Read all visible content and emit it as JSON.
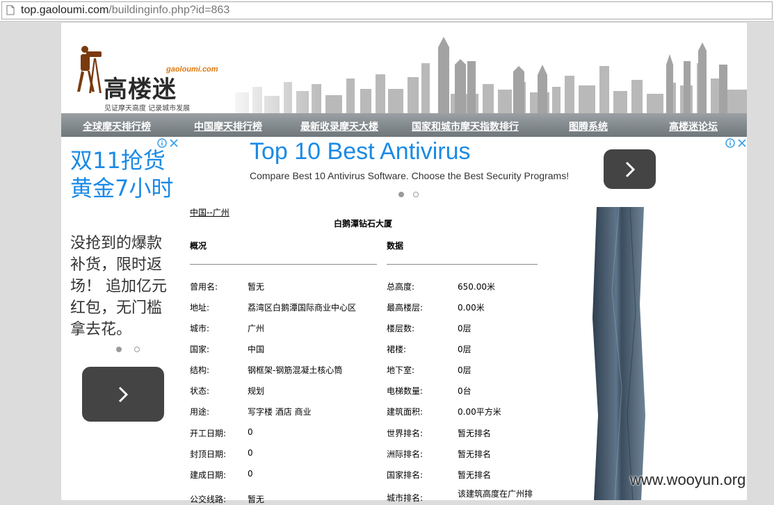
{
  "browser": {
    "url_host": "top.gaoloumi.com",
    "url_path": "/buildinginfo.php?id=863"
  },
  "logo": {
    "name": "高楼迷",
    "domain": "gaoloumi.com",
    "slogan": "见证摩天高度 记录城市发展"
  },
  "nav": {
    "items": [
      "全球摩天排行榜",
      "中国摩天排行榜",
      "最新收录摩天大楼",
      "国家和城市摩天指数排行",
      "图腾系统",
      "高楼迷论坛"
    ]
  },
  "ad_left": {
    "headline": "双11抢货黄金7小时",
    "body": "没抢到的爆款补货，限时返场！ 追加亿元红包，无门槛拿去花。",
    "button_icon": "chevron-right-icon"
  },
  "ad_top": {
    "title": "Top 10 Best Antivirus",
    "subtitle": "Compare Best 10 Antivirus Software. Choose the Best Security Programs!",
    "button_icon": "chevron-right-icon"
  },
  "building": {
    "breadcrumb_country": "中国",
    "breadcrumb_sep": "--",
    "breadcrumb_city": "广州",
    "name": "白鹅潭钻石大厦",
    "overview_heading": "概况",
    "data_heading": "数据",
    "overview": [
      {
        "label": "曾用名:",
        "value": "暂无"
      },
      {
        "label": "地址:",
        "value": "荔湾区白鹅潭国际商业中心区"
      },
      {
        "label": "城市:",
        "value": "广州"
      },
      {
        "label": "国家:",
        "value": "中国"
      },
      {
        "label": "结构:",
        "value": "钢框架-钢筋混凝土核心筒"
      },
      {
        "label": "状态:",
        "value": "规划"
      },
      {
        "label": "用途:",
        "value": "写字楼 酒店 商业"
      },
      {
        "label": "开工日期:",
        "value": "0"
      },
      {
        "label": "封顶日期:",
        "value": "0"
      },
      {
        "label": "建成日期:",
        "value": "0"
      },
      {
        "label": "公交线路:",
        "value": "暂无"
      }
    ],
    "data": [
      {
        "label": "总高度:",
        "value": "650.00米"
      },
      {
        "label": "最高楼层:",
        "value": "0.00米"
      },
      {
        "label": "楼层数:",
        "value": "0层"
      },
      {
        "label": "裙楼:",
        "value": "0层"
      },
      {
        "label": "地下室:",
        "value": "0层"
      },
      {
        "label": "电梯数量:",
        "value": "0台"
      },
      {
        "label": "建筑面积:",
        "value": "0.00平方米"
      },
      {
        "label": "世界排名:",
        "value": "暂无排名"
      },
      {
        "label": "洲际排名:",
        "value": "暂无排名"
      },
      {
        "label": "国家排名:",
        "value": "暂无排名"
      },
      {
        "label": "城市排名:",
        "value": "该建筑高度在广州排"
      }
    ]
  },
  "watermark": "www.wooyun.org",
  "colors": {
    "nav_bg": "#7d8488",
    "ad_link": "#1a8ae6",
    "ad_button": "#444444",
    "ad_choices": "#3aa0e8"
  }
}
